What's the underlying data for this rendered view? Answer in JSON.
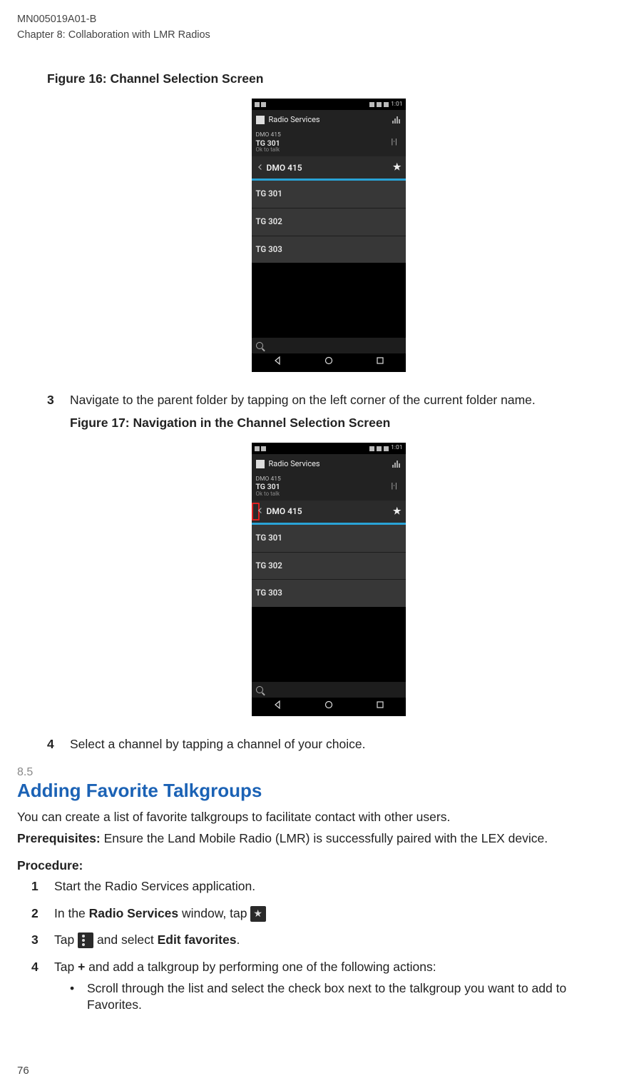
{
  "header": {
    "doc_id": "MN005019A01-B",
    "chapter": "Chapter 8:  Collaboration with LMR Radios"
  },
  "fig16": {
    "title": "Figure 16: Channel Selection Screen"
  },
  "fig17": {
    "title": "Figure 17: Navigation in the Channel Selection Screen"
  },
  "phone": {
    "time": "1:01",
    "app_title": "Radio Services",
    "info": {
      "line1": "DMO 415",
      "line2": "TG 301",
      "line3": "Ok to talk",
      "icon": "|·|"
    },
    "folder": "DMO 415",
    "star": "★",
    "items": [
      "TG 301",
      "TG 302",
      "TG 303"
    ],
    "nav": {
      "back": "◁",
      "home": "○",
      "recent": "□"
    }
  },
  "step3": {
    "num": "3",
    "text": "Navigate to the parent folder by tapping on the left corner of the current folder name."
  },
  "step4": {
    "num": "4",
    "text": "Select a channel by tapping a channel of your choice."
  },
  "section": {
    "num": "8.5",
    "title": "Adding Favorite Talkgroups",
    "intro": "You can create a list of favorite talkgroups to facilitate contact with other users.",
    "prereq_label": "Prerequisites:",
    "prereq_text": " Ensure the Land Mobile Radio (LMR) is successfully paired with the LEX device.",
    "procedure_label": "Procedure:",
    "p1": {
      "num": "1",
      "text": "Start the Radio Services application."
    },
    "p2": {
      "num": "2",
      "pre": "In the ",
      "bold": "Radio Services",
      "post": " window, tap "
    },
    "p3": {
      "num": "3",
      "pre": "Tap ",
      "post": " and select ",
      "bold": "Edit favorites",
      "end": "."
    },
    "p4": {
      "num": "4",
      "pre": "Tap ",
      "plus": "+",
      "post": " and add a talkgroup by performing one of the following actions:",
      "bullet": "Scroll through the list and select the check box next to the talkgroup you want to add to Favorites.",
      "dot": "•"
    }
  },
  "page_number": "76"
}
